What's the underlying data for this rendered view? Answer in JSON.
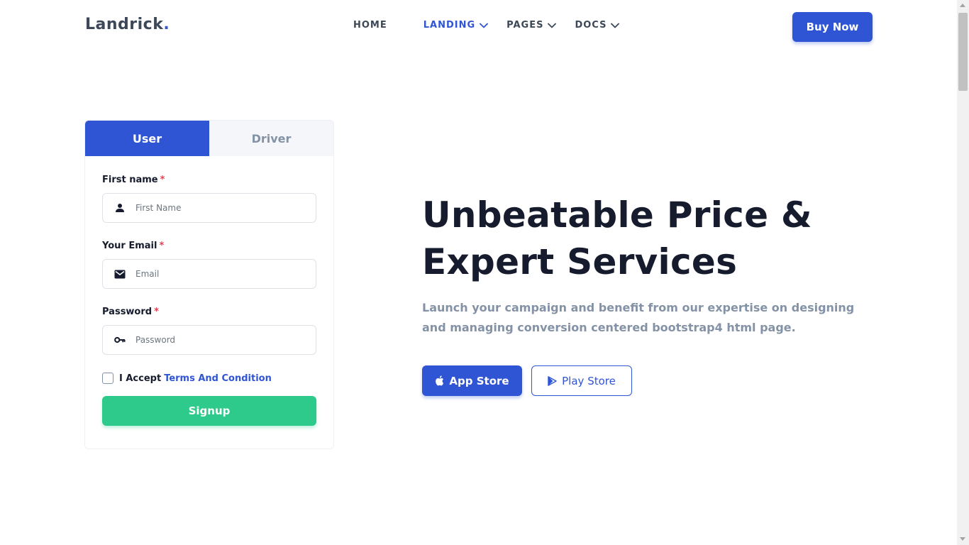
{
  "brand": {
    "name": "Landrick",
    "dot": "."
  },
  "nav": {
    "items": [
      {
        "label": "HOME",
        "has_dropdown": false,
        "active": false
      },
      {
        "label": "LANDING",
        "has_dropdown": true,
        "active": true
      },
      {
        "label": "PAGES",
        "has_dropdown": true,
        "active": false
      },
      {
        "label": "DOCS",
        "has_dropdown": true,
        "active": false
      }
    ],
    "cta_label": "Buy Now"
  },
  "signup_card": {
    "tabs": [
      {
        "label": "User",
        "active": true
      },
      {
        "label": "Driver",
        "active": false
      }
    ],
    "fields": {
      "first_name": {
        "label": "First name",
        "required_mark": "*",
        "placeholder": "First Name",
        "value": "",
        "icon": "user-icon"
      },
      "email": {
        "label": "Your Email",
        "required_mark": "*",
        "placeholder": "Email",
        "value": "",
        "icon": "mail-icon"
      },
      "password": {
        "label": "Password",
        "required_mark": "*",
        "placeholder": "Password",
        "value": "",
        "icon": "key-icon"
      }
    },
    "terms": {
      "prefix": "I Accept",
      "link": "Terms And Condition",
      "checked": false
    },
    "submit_label": "Signup"
  },
  "hero": {
    "title_line1": "Unbeatable Price &",
    "title_line2": "Expert Services",
    "subtitle": "Launch your campaign and benefit from our expertise on designing and managing conversion centered bootstrap4 html page.",
    "buttons": {
      "app_store": {
        "label": "App Store",
        "icon": "apple-icon"
      },
      "play_store": {
        "label": "Play Store",
        "icon": "play-store-icon"
      }
    }
  },
  "colors": {
    "primary": "#2f55d4",
    "success": "#2eca8b",
    "heading": "#161c2d",
    "muted": "#8492a6",
    "danger": "#e43f52"
  }
}
